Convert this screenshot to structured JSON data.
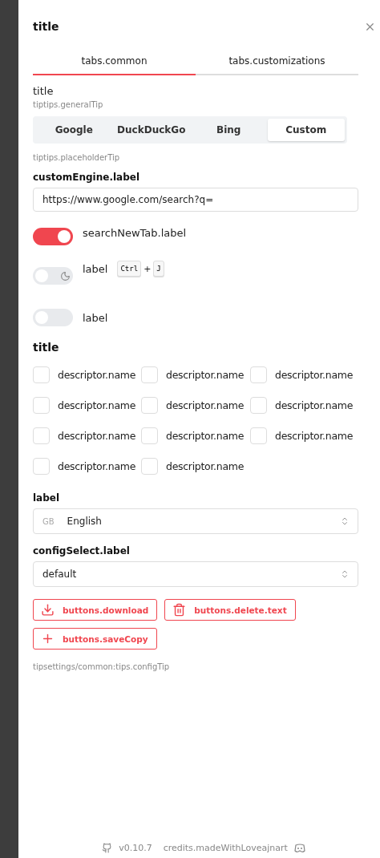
{
  "panel": {
    "title": "title"
  },
  "tabs": [
    {
      "label": "tabs.common",
      "selected": true
    },
    {
      "label": "tabs.customizations",
      "selected": false
    }
  ],
  "search_engine": {
    "title": "title",
    "tip": "tiptips.generalTip",
    "options": [
      {
        "label": "Google",
        "selected": false
      },
      {
        "label": "DuckDuckGo",
        "selected": false
      },
      {
        "label": "Bing",
        "selected": false
      },
      {
        "label": "Custom",
        "selected": true
      }
    ],
    "placeholder_tip": "tiptips.placeholderTip",
    "field_label": "customEngine.label",
    "field_value": "https://www.google.com/search?q="
  },
  "toggles": [
    {
      "kind": "plain",
      "label": "searchNewTab.label",
      "on": true
    },
    {
      "kind": "theme",
      "label": "label",
      "on": false,
      "keys": [
        "Ctrl",
        "J"
      ],
      "joiner": "+"
    },
    {
      "kind": "plain",
      "label": "label",
      "on": false
    }
  ],
  "descriptors": {
    "title": "title",
    "items": [
      {
        "label": "descriptor.name",
        "checked": false
      },
      {
        "label": "descriptor.name",
        "checked": false
      },
      {
        "label": "descriptor.name",
        "checked": false
      },
      {
        "label": "descriptor.name",
        "checked": false
      },
      {
        "label": "descriptor.name",
        "checked": false
      },
      {
        "label": "descriptor.name",
        "checked": false
      },
      {
        "label": "descriptor.name",
        "checked": false
      },
      {
        "label": "descriptor.name",
        "checked": false
      },
      {
        "label": "descriptor.name",
        "checked": false
      },
      {
        "label": "descriptor.name",
        "checked": false
      },
      {
        "label": "descriptor.name",
        "checked": false
      }
    ]
  },
  "language": {
    "label": "label",
    "flag": "GB",
    "value": "English"
  },
  "config": {
    "label": "configSelect.label",
    "value": "default"
  },
  "buttons": [
    {
      "kind": "download",
      "label": "buttons.download"
    },
    {
      "kind": "delete",
      "label": "buttons.delete.text"
    },
    {
      "kind": "add",
      "label": "buttons.saveCopy"
    }
  ],
  "config_tip": "tipsettings/common:tips.configTip",
  "footer": {
    "version": "v0.10.7",
    "credits": "credits.madeWithLoveajnart"
  }
}
